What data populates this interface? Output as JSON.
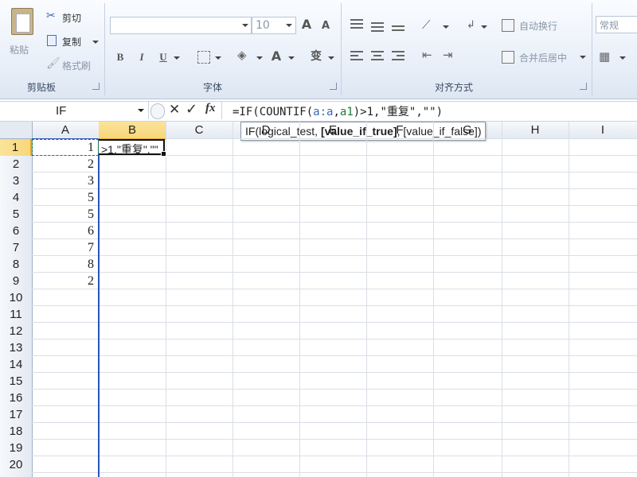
{
  "clipboard": {
    "paste_label": "粘贴",
    "cut_label": "剪切",
    "copy_label": "复制",
    "format_painter_label": "格式刷",
    "group_label": "剪贴板"
  },
  "font": {
    "font_name": "",
    "font_size": "10",
    "bold_label": "B",
    "italic_label": "I",
    "underline_label": "U",
    "grow_label": "A",
    "shrink_label": "A",
    "font_color_label": "A",
    "phonetic_label": "变",
    "group_label": "字体"
  },
  "alignment": {
    "wrap_text_label": "自动换行",
    "merge_center_label": "合并后居中",
    "group_label": "对齐方式"
  },
  "number": {
    "format_value": "常规"
  },
  "formula_bar": {
    "name_box": "IF",
    "formula_prefix": "=IF(COUNTIF(",
    "formula_ref1": "a:a",
    "formula_sep": ",",
    "formula_ref2": "a1",
    "formula_suffix": ")>1,\"重复\",\"\")"
  },
  "tooltip": {
    "prefix": "IF(logical_test, ",
    "bold_arg": "[value_if_true]",
    "suffix": ", [value_if_false])"
  },
  "columns": [
    "A",
    "B",
    "C",
    "D",
    "E",
    "F",
    "G",
    "H",
    "I"
  ],
  "rows": [
    "1",
    "2",
    "3",
    "4",
    "5",
    "6",
    "7",
    "8",
    "9",
    "10",
    "11",
    "12",
    "13",
    "14",
    "15",
    "16",
    "17",
    "18",
    "19",
    "20"
  ],
  "column_a_values": [
    "1",
    "2",
    "3",
    "5",
    "5",
    "6",
    "7",
    "8",
    "2"
  ],
  "active_cell": {
    "edit_text": ">1,\"重复\",\"\""
  },
  "colors": {
    "active_header": "#f7d77b",
    "formula_ref": "#3a66b8",
    "range_border": "#2a55b8",
    "selection_border": "#1e7a3a"
  }
}
